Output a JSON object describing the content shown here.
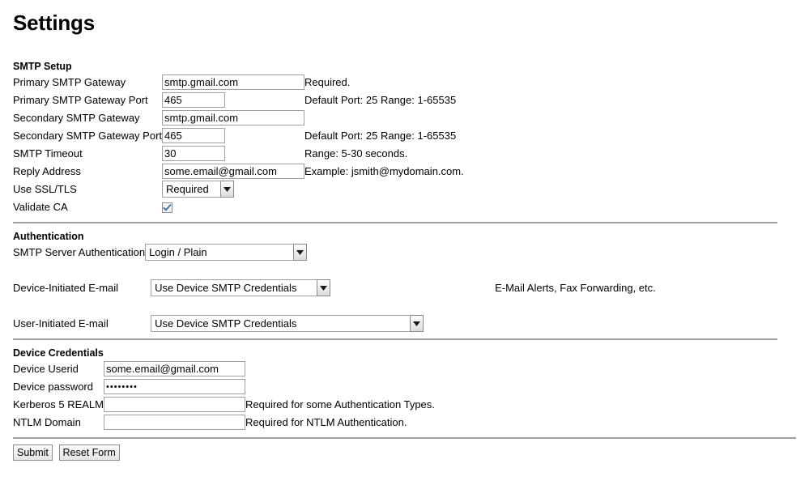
{
  "page": {
    "title": "Settings"
  },
  "smtp_setup": {
    "heading": "SMTP Setup",
    "rows": [
      {
        "label": "Primary SMTP Gateway",
        "value": "smtp.gmail.com",
        "hint": "Required."
      },
      {
        "label": "Primary SMTP Gateway Port",
        "value": "465",
        "hint": "Default Port: 25 Range: 1-65535"
      },
      {
        "label": "Secondary SMTP Gateway",
        "value": "smtp.gmail.com",
        "hint": ""
      },
      {
        "label": "Secondary SMTP Gateway Port",
        "value": "465",
        "hint": "Default Port: 25 Range: 1-65535"
      },
      {
        "label": "SMTP Timeout",
        "value": "30",
        "hint": "Range: 5-30 seconds."
      },
      {
        "label": "Reply Address",
        "value": "some.email@gmail.com",
        "hint": "Example: jsmith@mydomain.com."
      }
    ],
    "ssl": {
      "label": "Use SSL/TLS",
      "value": "Required",
      "options": [
        "Required"
      ]
    },
    "validate_ca": {
      "label": "Validate CA",
      "checked": true
    }
  },
  "authentication": {
    "heading": "Authentication",
    "server_auth": {
      "label": "SMTP Server Authentication",
      "value": "Login / Plain",
      "hint": ""
    },
    "device_initiated": {
      "label": "Device-Initiated E-mail",
      "value": "Use Device SMTP Credentials",
      "hint": "E-Mail Alerts, Fax Forwarding, etc."
    },
    "user_initiated": {
      "label": "User-Initiated E-mail",
      "value": "Use Device SMTP Credentials",
      "hint": ""
    }
  },
  "device_credentials": {
    "heading": "Device Credentials",
    "rows": [
      {
        "label": "Device Userid",
        "value": "some.email@gmail.com",
        "hint": ""
      },
      {
        "label": "Device password",
        "value": "••••••••",
        "hint": ""
      },
      {
        "label": "Kerberos 5 REALM",
        "value": "",
        "hint": "Required for some Authentication Types."
      },
      {
        "label": "NTLM Domain",
        "value": "",
        "hint": "Required for NTLM Authentication."
      }
    ]
  },
  "actions": {
    "submit_label": "Submit",
    "reset_label": "Reset Form"
  },
  "colors": {
    "rule": "#9d9d9d",
    "input_border": "#a0a0a0",
    "checkmark": "#3a6ea5"
  }
}
